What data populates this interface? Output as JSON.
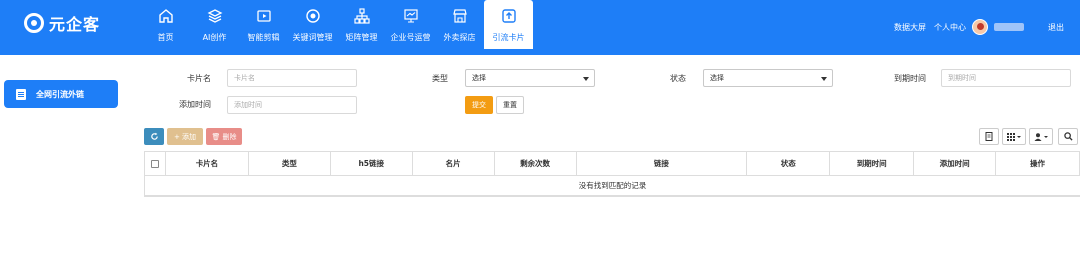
{
  "brand": {
    "name": "元企客"
  },
  "nav": {
    "items": [
      {
        "label": "首页",
        "icon": "home-icon"
      },
      {
        "label": "AI创作",
        "icon": "layers-icon"
      },
      {
        "label": "智能剪辑",
        "icon": "video-icon"
      },
      {
        "label": "关键词管理",
        "icon": "target-icon"
      },
      {
        "label": "矩阵管理",
        "icon": "hierarchy-icon"
      },
      {
        "label": "企业号运营",
        "icon": "presentation-icon"
      },
      {
        "label": "外卖探店",
        "icon": "store-icon"
      },
      {
        "label": "引流卡片",
        "icon": "upload-card-icon"
      }
    ],
    "active_index": 7
  },
  "header_right": {
    "dashboard": "数据大屏",
    "personal_center": "个人中心",
    "logout": "退出"
  },
  "sidebar": {
    "items": [
      {
        "label": "全网引流外链",
        "icon": "document-icon"
      }
    ]
  },
  "filters": {
    "card_name": {
      "label": "卡片名",
      "placeholder": "卡片名"
    },
    "type": {
      "label": "类型",
      "value": "选择"
    },
    "status": {
      "label": "状态",
      "value": "选择"
    },
    "expire_time": {
      "label": "到期时间",
      "placeholder": "到期时间"
    },
    "add_time": {
      "label": "添加时间",
      "placeholder": "添加时间"
    },
    "submit_label": "提交",
    "reset_label": "重置"
  },
  "toolbar": {
    "refresh_icon": "refresh-icon",
    "add_label": "+ 添加",
    "delete_label": "🗑 删除",
    "colors": {
      "refresh": "#3c8dbc",
      "add": "#e0c08f",
      "delete": "#e88d88"
    }
  },
  "table": {
    "columns": [
      "卡片名",
      "类型",
      "h5链接",
      "名片",
      "剩余次数",
      "链接",
      "状态",
      "到期时间",
      "添加时间",
      "操作"
    ],
    "empty_text": "没有找到匹配的记录"
  },
  "colors": {
    "primary": "#1e7ef7",
    "submit": "#f39c12"
  }
}
